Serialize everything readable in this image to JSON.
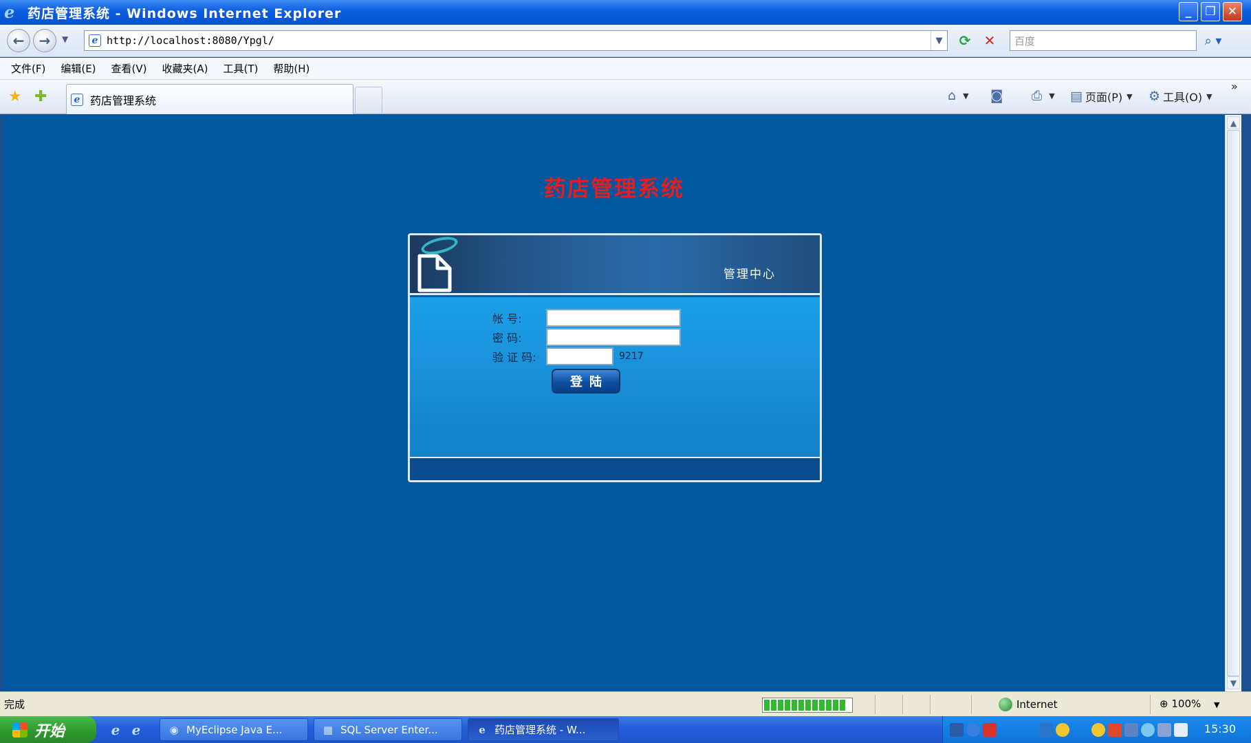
{
  "window": {
    "title": "药店管理系统 - Windows Internet Explorer",
    "minimize_label": "_",
    "maximize_label": "❐",
    "close_label": "✕"
  },
  "address": {
    "url": "http://localhost:8080/Ypgl/",
    "search_placeholder": "百度"
  },
  "menu": [
    "文件(F)",
    "编辑(E)",
    "查看(V)",
    "收藏夹(A)",
    "工具(T)",
    "帮助(H)"
  ],
  "tab": {
    "label": "药店管理系统"
  },
  "commands": {
    "page_label": "页面(P)",
    "tools_label": "工具(O)"
  },
  "page": {
    "title": "药店管理系统",
    "panel_header": "管理中心",
    "form": {
      "account_label": "帐    号:",
      "password_label": "密    码:",
      "captcha_label": "验 证 码:",
      "captcha_code": "9217",
      "login_button": "登陆"
    }
  },
  "status": {
    "text": "完成",
    "zone": "Internet",
    "zoom": "100%"
  },
  "taskbar": {
    "start_label": "开始",
    "tasks": [
      "MyEclipse Java E...",
      "SQL Server Enter...",
      "药店管理系统 - W..."
    ],
    "clock": "15:30"
  },
  "colors": {
    "page_background": "#02589e",
    "title_red": "#e02020",
    "panel_body": "#1a8fd8"
  }
}
